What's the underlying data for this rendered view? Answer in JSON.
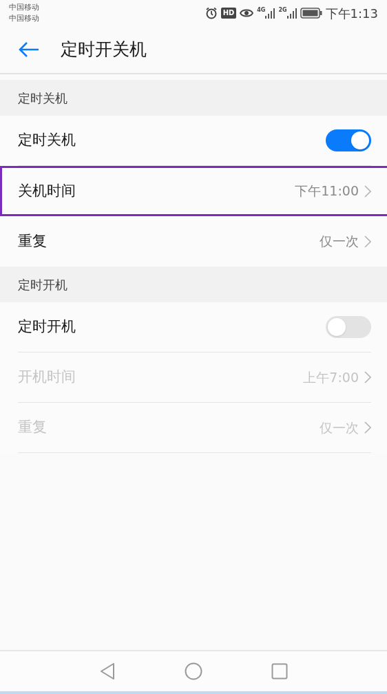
{
  "status_bar": {
    "carriers": [
      "中国移动",
      "中国移动"
    ],
    "hd_badge": "HD",
    "network_1": "4G",
    "network_2": "2G",
    "time": "下午1:13"
  },
  "header": {
    "title": "定时开关机"
  },
  "sections": [
    {
      "title": "定时关机",
      "items": [
        {
          "kind": "toggle",
          "label": "定时关机",
          "on": true,
          "disabled": false,
          "highlighted": false
        },
        {
          "kind": "link",
          "label": "关机时间",
          "value": "下午11:00",
          "disabled": false,
          "highlighted": true
        },
        {
          "kind": "link",
          "label": "重复",
          "value": "仅一次",
          "disabled": false,
          "highlighted": false
        }
      ]
    },
    {
      "title": "定时开机",
      "items": [
        {
          "kind": "toggle",
          "label": "定时开机",
          "on": false,
          "disabled": false,
          "highlighted": false
        },
        {
          "kind": "link",
          "label": "开机时间",
          "value": "上午7:00",
          "disabled": true,
          "highlighted": false
        },
        {
          "kind": "link",
          "label": "重复",
          "value": "仅一次",
          "disabled": true,
          "highlighted": false
        }
      ]
    }
  ]
}
